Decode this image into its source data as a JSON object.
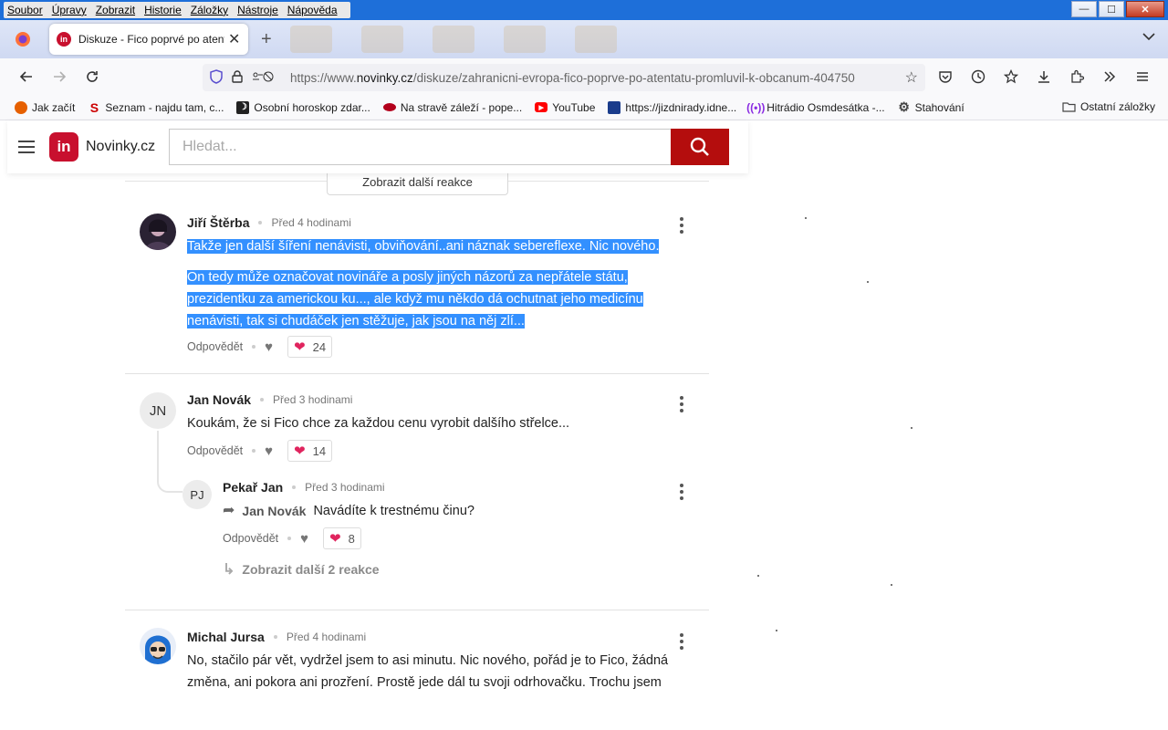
{
  "menubar": {
    "items": [
      "Soubor",
      "Úpravy",
      "Zobrazit",
      "Historie",
      "Záložky",
      "Nástroje",
      "Nápověda"
    ],
    "minimize": "—",
    "maximize": "☐",
    "close": "✕"
  },
  "browser": {
    "tab_title": "Diskuze - Fico poprvé po atentátu promluvil k občanům",
    "tab_close": "✕",
    "new_tab": "+",
    "url_prefix": "https://www.",
    "url_domain": "novinky.cz",
    "url_path": "/diskuze/zahranicni-evropa-fico-poprve-po-atentatu-promluvil-k-obcanum-404750",
    "bookmarks": [
      {
        "label": "Jak začít",
        "icon": "firefox-icon",
        "color": "#e66000"
      },
      {
        "label": "Seznam - najdu tam, c...",
        "icon": "seznam-icon",
        "color": "#cc0000"
      },
      {
        "label": "Osobní horoskop zdar...",
        "icon": "moon-icon",
        "color": "#222222"
      },
      {
        "label": "Na stravě záleží - pope...",
        "icon": "lips-icon",
        "color": "#b3001b"
      },
      {
        "label": "YouTube",
        "icon": "youtube-icon",
        "color": "#ff0000"
      },
      {
        "label": "https://jizdnirady.idne...",
        "icon": "timetable-icon",
        "color": "#1a3c8c"
      },
      {
        "label": "Hitrádio Osmdesátka -...",
        "icon": "radio-icon",
        "color": "#8a2be2"
      },
      {
        "label": "Stahování",
        "icon": "gear-icon",
        "color": "#444444"
      }
    ],
    "other_bookmarks": "Ostatní záložky"
  },
  "site": {
    "logo_badge": "in",
    "logo_text": "Novinky.cz",
    "search_placeholder": "Hledat..."
  },
  "discussion": {
    "show_more_top": "Zobrazit další reakce",
    "reply_label": "Odpovědět",
    "comments": [
      {
        "author": "Jiří Štěrba",
        "time": "Před 4 hodinami",
        "paragraphs": [
          "Takže jen další šíření nenávisti, obviňování..ani náznak sebereflexe. Nic nového.",
          "On tedy může označovat novináře a posly jiných názorů za nepřátele státu, prezidentku za americkou ku..., ale když mu někdo dá ochutnat jeho medicínu nenávisti, tak si chudáček jen stěžuje, jak jsou na něj zlí..."
        ],
        "reactions": "24"
      },
      {
        "author": "Jan Novák",
        "initials": "JN",
        "time": "Před 3 hodinami",
        "text": "Koukám, že si Fico chce za každou cenu vyrobit dalšího střelce...",
        "reactions": "14"
      },
      {
        "author": "Pekař Jan",
        "initials": "PJ",
        "time": "Před 3 hodinami",
        "reply_to": "Jan Novák",
        "text": "Navádíte k trestnému činu?",
        "reactions": "8",
        "show_more": "Zobrazit další 2 reakce"
      },
      {
        "author": "Michal Jursa",
        "time": "Před 4 hodinami",
        "text": "No, stačilo pár vět, vydržel jsem to asi minutu. Nic nového, pořád je to Fico, žádná změna, ani pokora ani prozření. Prostě jede dál tu svoji odrhovačku. Trochu jsem"
      }
    ]
  },
  "colors": {
    "brand_red": "#c8102e",
    "search_button": "#b40d0d",
    "selection": "#3390ff",
    "titlebar_blue": "#1e6fd9"
  }
}
